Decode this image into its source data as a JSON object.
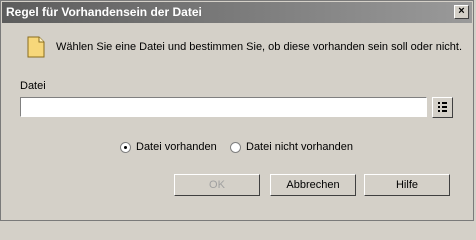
{
  "dialog": {
    "title": "Regel für Vorhandensein der Datei",
    "close_glyph": "×",
    "intro_text": "Wählen Sie eine Datei und bestimmen Sie, ob diese vorhanden sein soll oder nicht.",
    "icon": "document-icon"
  },
  "file": {
    "label": "Datei",
    "value": "",
    "browse_icon": "browse-icon"
  },
  "radios": [
    {
      "label": "Datei vorhanden",
      "checked": true
    },
    {
      "label": "Datei nicht vorhanden",
      "checked": false
    }
  ],
  "buttons": {
    "ok": "OK",
    "ok_enabled": false,
    "cancel": "Abbrechen",
    "help": "Hilfe"
  }
}
